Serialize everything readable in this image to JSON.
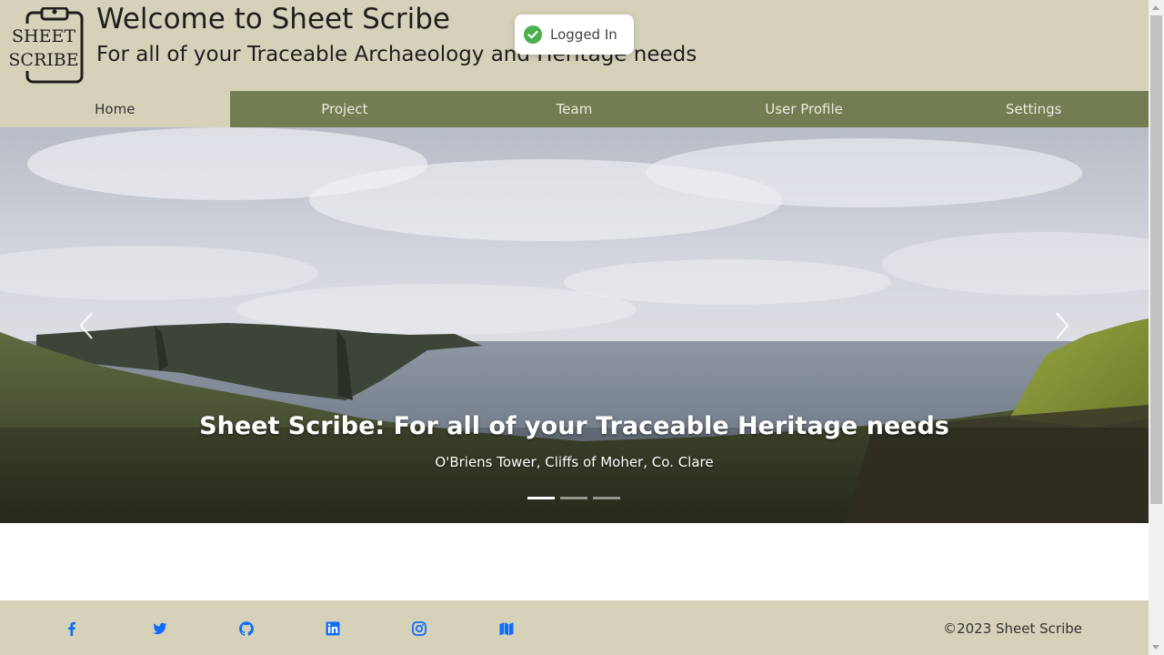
{
  "header": {
    "logo_line1": "SHEET",
    "logo_line2": "SCRIBE",
    "title": "Welcome to Sheet Scribe",
    "subtitle": "For all of your Traceable Archaeology and Heritage needs"
  },
  "toast": {
    "text": "Logged In",
    "icon": "check-circle-icon",
    "color": "#4caf50"
  },
  "nav": {
    "items": [
      {
        "label": "Home",
        "active": true
      },
      {
        "label": "Project",
        "active": false
      },
      {
        "label": "Team",
        "active": false
      },
      {
        "label": "User Profile",
        "active": false
      },
      {
        "label": "Settings",
        "active": false
      }
    ]
  },
  "carousel": {
    "title": "Sheet Scribe: For all of your Traceable Heritage needs",
    "subtitle": "O'Briens Tower, Cliffs of Moher, Co. Clare",
    "slide_count": 3,
    "active_slide": 1
  },
  "footer": {
    "social": [
      "facebook-icon",
      "twitter-icon",
      "github-icon",
      "linkedin-icon",
      "instagram-icon",
      "map-icon"
    ],
    "copyright": "©2023 Sheet Scribe"
  },
  "colors": {
    "header_bg": "#d6d1b9",
    "nav_bg": "#727d51",
    "link_blue": "#0d6efd"
  }
}
